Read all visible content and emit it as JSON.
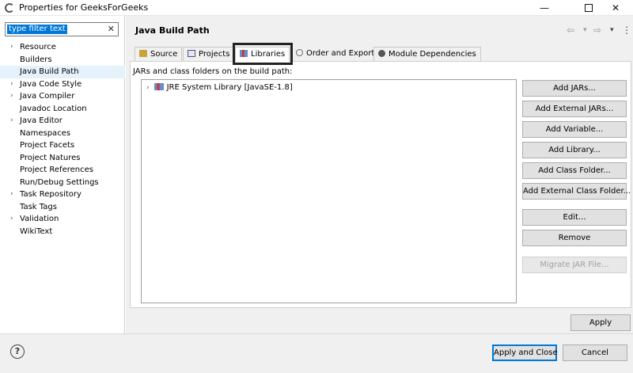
{
  "window": {
    "title": "Properties for GeeksForGeeks",
    "controls": {
      "minimize": "—",
      "close": "✕"
    }
  },
  "filter": {
    "text": "type filter text",
    "clear": "✕"
  },
  "tree": {
    "items": [
      {
        "label": "Resource",
        "expandable": true
      },
      {
        "label": "Builders",
        "expandable": false
      },
      {
        "label": "Java Build Path",
        "expandable": false,
        "selected": true
      },
      {
        "label": "Java Code Style",
        "expandable": true
      },
      {
        "label": "Java Compiler",
        "expandable": true
      },
      {
        "label": "Javadoc Location",
        "expandable": false
      },
      {
        "label": "Java Editor",
        "expandable": true
      },
      {
        "label": "Namespaces",
        "expandable": false
      },
      {
        "label": "Project Facets",
        "expandable": false
      },
      {
        "label": "Project Natures",
        "expandable": false
      },
      {
        "label": "Project References",
        "expandable": false
      },
      {
        "label": "Run/Debug Settings",
        "expandable": false
      },
      {
        "label": "Task Repository",
        "expandable": true
      },
      {
        "label": "Task Tags",
        "expandable": false
      },
      {
        "label": "Validation",
        "expandable": true
      },
      {
        "label": "WikiText",
        "expandable": false
      }
    ]
  },
  "header": {
    "title": "Java Build Path",
    "nav": {
      "back": "⇦",
      "forward": "⇨",
      "dropdown": "▾",
      "menu": "⋮"
    }
  },
  "tabs": [
    {
      "label": "Source",
      "icon": "source-folder-icon"
    },
    {
      "label": "Projects",
      "icon": "projects-icon"
    },
    {
      "label": "Libraries",
      "icon": "libraries-icon",
      "active": true
    },
    {
      "label": "Order and Export",
      "icon": "order-export-icon"
    },
    {
      "label": "Module Dependencies",
      "icon": "module-icon"
    }
  ],
  "libraries": {
    "description": "JARs and class folders on the build path:",
    "entries": [
      {
        "label": "JRE System Library [JavaSE-1.8]"
      }
    ]
  },
  "side_buttons": {
    "add_jars": "Add JARs...",
    "add_external_jars": "Add External JARs...",
    "add_variable": "Add Variable...",
    "add_library": "Add Library...",
    "add_class_folder": "Add Class Folder...",
    "add_external_class_folder": "Add External Class Folder...",
    "edit": "Edit...",
    "remove": "Remove",
    "migrate_jar": "Migrate JAR File..."
  },
  "apply_label": "Apply",
  "footer": {
    "help": "?",
    "apply_and_close": "Apply and Close",
    "cancel": "Cancel"
  },
  "colors": {
    "selection": "#0078d7",
    "tree_selected": "#e5f1fb",
    "dialog_bg": "#f0f0f0",
    "highlight_box": "#222222"
  }
}
